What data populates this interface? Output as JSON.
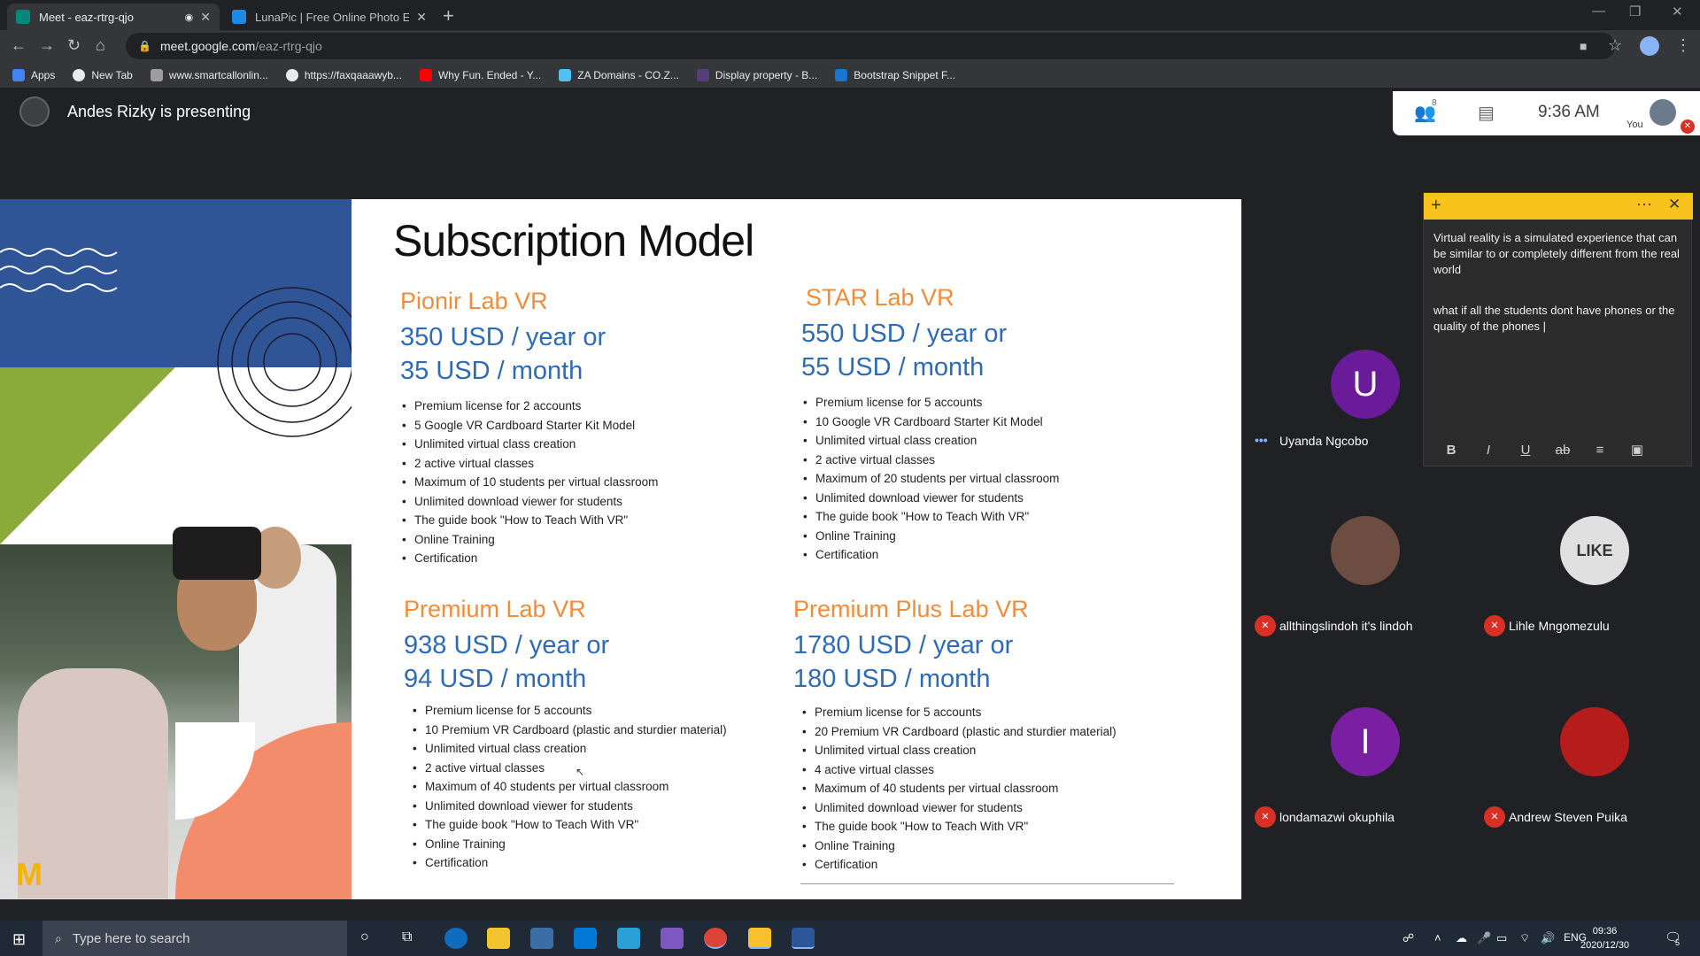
{
  "browser": {
    "tabs": [
      {
        "title": "Meet - eaz-rtrg-qjo",
        "favicon": "google-meet-icon",
        "active": true
      },
      {
        "title": "LunaPic | Free Online Photo Edit",
        "favicon": "lunapic-icon",
        "active": false
      }
    ],
    "url_host": "meet.google.com",
    "url_path": "/eaz-rtrg-qjo",
    "bookmarks": [
      "Apps",
      "New Tab",
      "www.smartcallonlin...",
      "https://faxqaaawyb...",
      "Why Fun. Ended - Y...",
      "ZA Domains - CO.Z...",
      "Display property - B...",
      "Bootstrap Snippet F..."
    ]
  },
  "meet": {
    "presenter_label": "Andes Rizky is presenting",
    "participant_count": "8",
    "clock": "9:36 AM",
    "you_label": "You"
  },
  "slide": {
    "title": "Subscription Model",
    "plans": [
      {
        "name": "Pionir Lab VR",
        "price_year": "350 USD / year or",
        "price_month": "35 USD / month",
        "features": [
          "Premium license for 2 accounts",
          "5 Google VR Cardboard Starter Kit Model",
          "Unlimited virtual class creation",
          "2 active virtual classes",
          "Maximum of 10 students per virtual classroom",
          "Unlimited download viewer for students",
          "The guide book \"How to Teach With VR\"",
          "Online Training",
          "Certification"
        ]
      },
      {
        "name": "STAR Lab VR",
        "price_year": "550 USD / year or",
        "price_month": "55 USD / month",
        "features": [
          "Premium license for 5 accounts",
          "10 Google VR Cardboard Starter Kit Model",
          "Unlimited virtual class creation",
          "2 active virtual classes",
          "Maximum of 20 students per virtual classroom",
          "Unlimited download viewer for students",
          "The guide book \"How to Teach With VR\"",
          "Online Training",
          "Certification"
        ]
      },
      {
        "name": "Premium Lab VR",
        "price_year": "938 USD / year or",
        "price_month": "94 USD / month",
        "features": [
          "Premium license for 5 accounts",
          "10 Premium VR Cardboard (plastic and sturdier material)",
          "Unlimited virtual class creation",
          "2 active virtual classes",
          "Maximum of 40 students per virtual classroom",
          "Unlimited download viewer for students",
          "The guide book \"How to Teach With VR\"",
          "Online Training",
          "Certification"
        ]
      },
      {
        "name": "Premium Plus Lab VR",
        "price_year": "1780 USD / year or",
        "price_month": "180 USD / month",
        "features": [
          "Premium license for 5 accounts",
          "20 Premium VR Cardboard (plastic and sturdier material)",
          "Unlimited virtual class creation",
          "4 active virtual classes",
          "Maximum of 40 students per virtual classroom",
          "Unlimited download viewer for students",
          "The guide book \"How to Teach With VR\"",
          "Online Training",
          "Certification"
        ]
      }
    ]
  },
  "participants": [
    {
      "name": "Uyanda Ngcobo",
      "initial": "U",
      "color": "#6a1b9a",
      "muted": false
    },
    {
      "name": "allthingslindoh it's lindoh",
      "initial": "",
      "color": "#6d4c41",
      "muted": true
    },
    {
      "name": "Lihle Mngomezulu",
      "initial": "",
      "color": "#e0e0e0",
      "muted": true
    },
    {
      "name": "londamazwi okuphila",
      "initial": "I",
      "color": "#7b1fa2",
      "muted": true
    },
    {
      "name": "Andrew Steven Puika",
      "initial": "",
      "color": "#b71c1c",
      "muted": true
    }
  ],
  "sticky_note": {
    "paragraph1": "Virtual reality is a simulated experience that can be similar to or completely different from the real world",
    "paragraph2": "what  if all the students dont have phones  or the quality of the phones |",
    "tools": [
      "B",
      "I",
      "U",
      "ab",
      "≡",
      "▣"
    ]
  },
  "taskbar": {
    "search_placeholder": "Type here to search",
    "language": "ENG",
    "time": "09:36",
    "date": "2020/12/30",
    "notification_count": "5"
  }
}
